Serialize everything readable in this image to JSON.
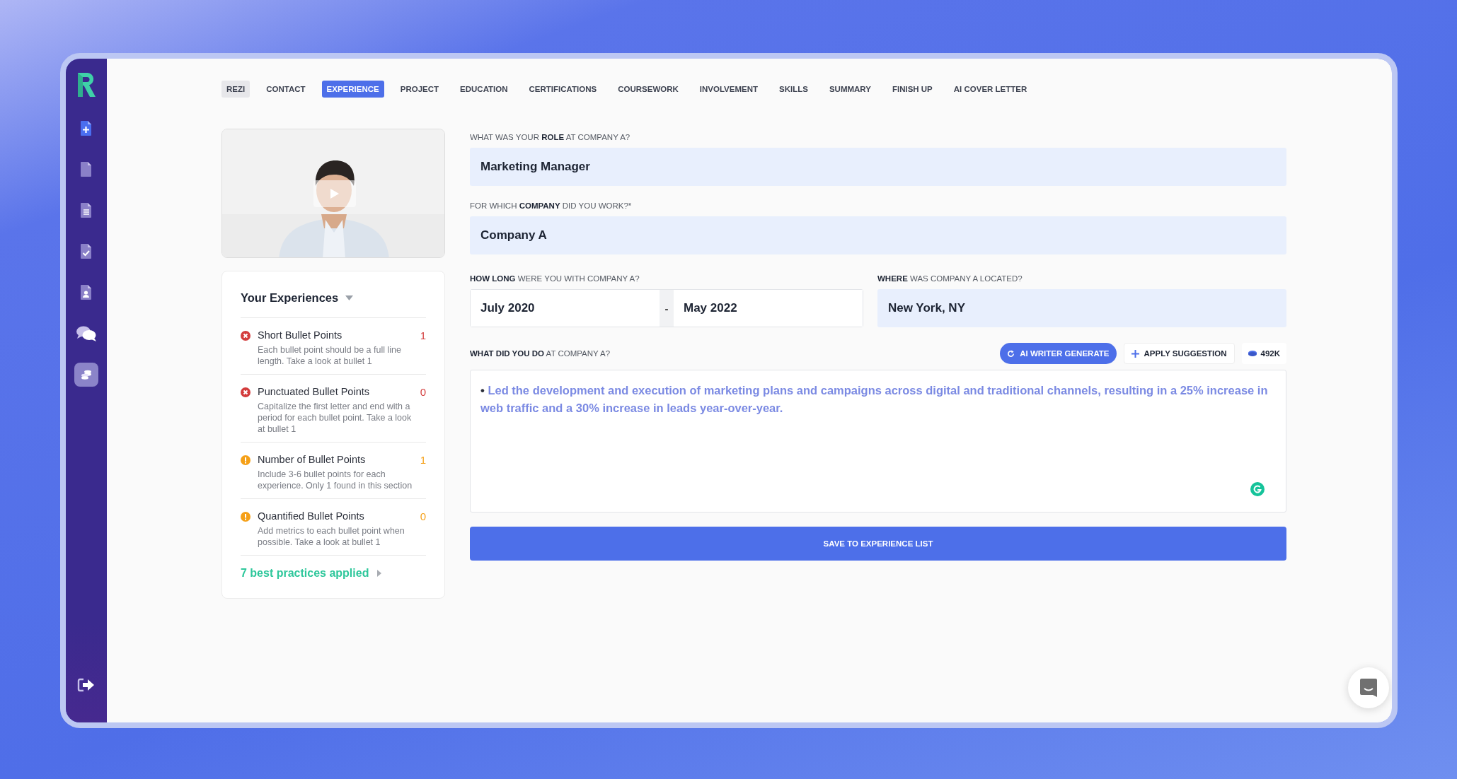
{
  "sidebar": {
    "items": [
      {
        "kind": "new-document",
        "selected": false
      },
      {
        "kind": "document",
        "selected": false
      },
      {
        "kind": "lined-document",
        "selected": false
      },
      {
        "kind": "checked-document",
        "selected": false
      },
      {
        "kind": "profile-document",
        "selected": false
      },
      {
        "kind": "chat",
        "selected": false
      },
      {
        "kind": "coins",
        "selected": true
      }
    ]
  },
  "tabs": [
    {
      "label": "REZI",
      "kind": "home",
      "selected": false
    },
    {
      "label": "CONTACT",
      "kind": "step",
      "selected": false
    },
    {
      "label": "EXPERIENCE",
      "kind": "step",
      "selected": true
    },
    {
      "label": "PROJECT",
      "kind": "step",
      "selected": false
    },
    {
      "label": "EDUCATION",
      "kind": "step",
      "selected": false
    },
    {
      "label": "CERTIFICATIONS",
      "kind": "step",
      "selected": false
    },
    {
      "label": "COURSEWORK",
      "kind": "step",
      "selected": false
    },
    {
      "label": "INVOLVEMENT",
      "kind": "step",
      "selected": false
    },
    {
      "label": "SKILLS",
      "kind": "step",
      "selected": false
    },
    {
      "label": "SUMMARY",
      "kind": "step",
      "selected": false
    },
    {
      "label": "FINISH UP",
      "kind": "step",
      "selected": false
    },
    {
      "label": "AI COVER LETTER",
      "kind": "step",
      "selected": false
    }
  ],
  "experiences": {
    "title": "Your Experiences",
    "checks": [
      {
        "kind": "error",
        "title": "Short Bullet Points",
        "count": "1",
        "description": "Each bullet point should be a full line length. Take a look at bullet 1"
      },
      {
        "kind": "error",
        "title": "Punctuated Bullet Points",
        "count": "0",
        "description": "Capitalize the first letter and end with a period for each bullet point. Take a look at bullet 1"
      },
      {
        "kind": "warning",
        "title": "Number of Bullet Points",
        "count": "1",
        "description": "Include 3-6 bullet points for each experience. Only 1 found in this section"
      },
      {
        "kind": "warning",
        "title": "Quantified Bullet Points",
        "count": "0",
        "description": "Add metrics to each bullet point when possible. Take a look at bullet 1"
      }
    ],
    "footer": "7 best practices applied"
  },
  "form": {
    "role": {
      "label": "WHAT WAS YOUR **ROLE** AT COMPANY A?",
      "value": "Marketing Manager"
    },
    "company": {
      "label": "FOR WHICH **COMPANY** DID YOU WORK?*",
      "value": "Company A"
    },
    "duration": {
      "label": "**HOW LONG** WERE YOU WITH COMPANY A?",
      "start": "July 2020",
      "separator": "-",
      "end": "May 2022"
    },
    "location": {
      "label": "**WHERE** WAS COMPANY A LOCATED?",
      "value": "New York, NY"
    },
    "duties": {
      "label": "**WHAT DID YOU DO** AT COMPANY A?",
      "bullet": "•",
      "text": "Led the development and execution of marketing plans and campaigns across digital and traditional channels, resulting in a 25% increase in web traffic and a 30% increase in leads year-over-year."
    },
    "actions": {
      "generate": "AI WRITER GENERATE",
      "apply": "APPLY SUGGESTION",
      "credits": "492K"
    },
    "save": "SAVE TO EXPERIENCE LIST"
  }
}
